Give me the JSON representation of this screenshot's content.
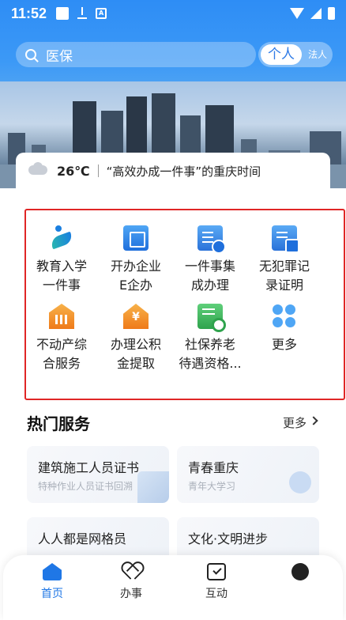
{
  "status_bar": {
    "time": "11:52",
    "badge_letter": "A"
  },
  "search": {
    "placeholder": "医保"
  },
  "segment": {
    "personal": "个人",
    "legal": "法人"
  },
  "weather": {
    "temperature": "26℃",
    "slogan": "“高效办成一件事”的重庆时间"
  },
  "services": [
    {
      "label_line1": "教育入学",
      "label_line2": "一件事",
      "icon": "education-icon"
    },
    {
      "label_line1": "开办企业",
      "label_line2": "E企办",
      "icon": "business-icon"
    },
    {
      "label_line1": "一件事集",
      "label_line2": "成办理",
      "icon": "one-thing-icon"
    },
    {
      "label_line1": "无犯罪记",
      "label_line2": "录证明",
      "icon": "no-crime-icon"
    },
    {
      "label_line1": "不动产综",
      "label_line2": "合服务",
      "icon": "real-estate-icon"
    },
    {
      "label_line1": "办理公积",
      "label_line2": "金提取",
      "icon": "fund-icon"
    },
    {
      "label_line1": "社保养老",
      "label_line2": "待遇资格...",
      "icon": "social-security-icon"
    },
    {
      "label_line1": "更多",
      "label_line2": "",
      "icon": "more-icon"
    }
  ],
  "hot": {
    "title": "热门服务",
    "more": "更多",
    "cards": [
      {
        "title": "建筑施工人员证书",
        "subtitle": "特种作业人员证书回溯"
      },
      {
        "title": "青春重庆",
        "subtitle": "青年大学习"
      },
      {
        "title": "人人都是网格员",
        "subtitle": ""
      },
      {
        "title": "文化·文明进步",
        "subtitle": ""
      }
    ]
  },
  "nav": {
    "home": "首页",
    "affairs": "办事",
    "interact": "互动"
  },
  "colors": {
    "primary": "#1f77e6",
    "highlight_border": "#e02626"
  }
}
